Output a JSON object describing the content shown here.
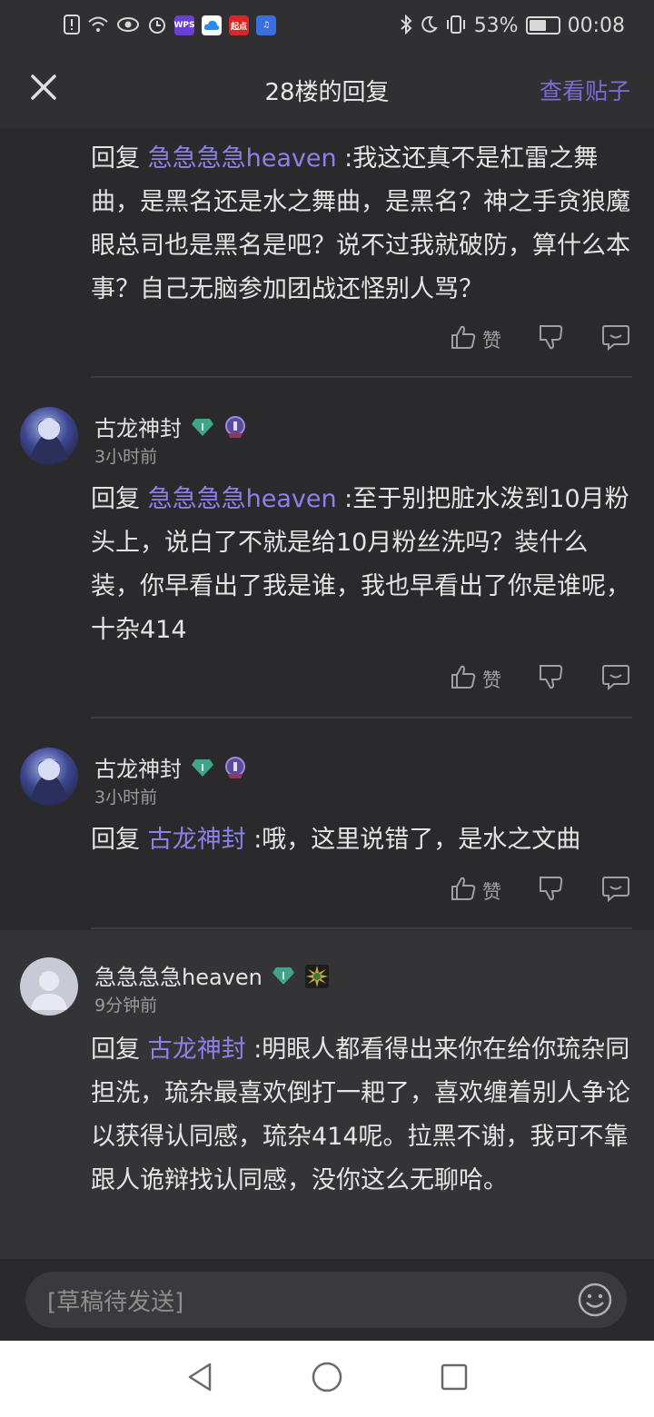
{
  "status_bar": {
    "battery": "53%",
    "time": "00:08",
    "app_badge_1": "WPS",
    "app_badge_2": "起点"
  },
  "header": {
    "title": "28楼的回复",
    "view_post": "查看贴子"
  },
  "replies": [
    {
      "prefix": "回复",
      "mention": "急急急急heaven",
      "text": ":我这还真不是杠雷之舞曲，是黑名还是水之舞曲，是黑名？神之手贪狼魔眼总司也是黑名是吧？说不过我就破防，算什么本事？自己无脑参加团战还怪别人骂？",
      "like_label": "赞"
    },
    {
      "username": "古龙神封",
      "time": "3小时前",
      "prefix": "回复",
      "mention": "急急急急heaven",
      "text": ":至于别把脏水泼到10月粉头上，说白了不就是给10月粉丝洗吗？装什么装，你早看出了我是谁，我也早看出了你是谁呢，十杂414",
      "like_label": "赞"
    },
    {
      "username": "古龙神封",
      "time": "3小时前",
      "prefix": "回复",
      "mention": "古龙神封",
      "text": ":哦，这里说错了，是水之文曲",
      "like_label": "赞"
    },
    {
      "username": "急急急急heaven",
      "time": "9分钟前",
      "prefix": "回复",
      "mention": "古龙神封",
      "text": ":明眼人都看得出来你在给你琉杂同担洗，琉杂最喜欢倒打一耙了，喜欢缠着别人争论以获得认同感，琉杂414呢。拉黑不谢，我可不靠跟人诡辩找认同感，没你这么无聊哈。"
    }
  ],
  "input": {
    "placeholder": "[草稿待发送]"
  },
  "colors": {
    "accent": "#7b6cd6",
    "mention": "#8e80e8",
    "gem": "#3fa58a"
  }
}
